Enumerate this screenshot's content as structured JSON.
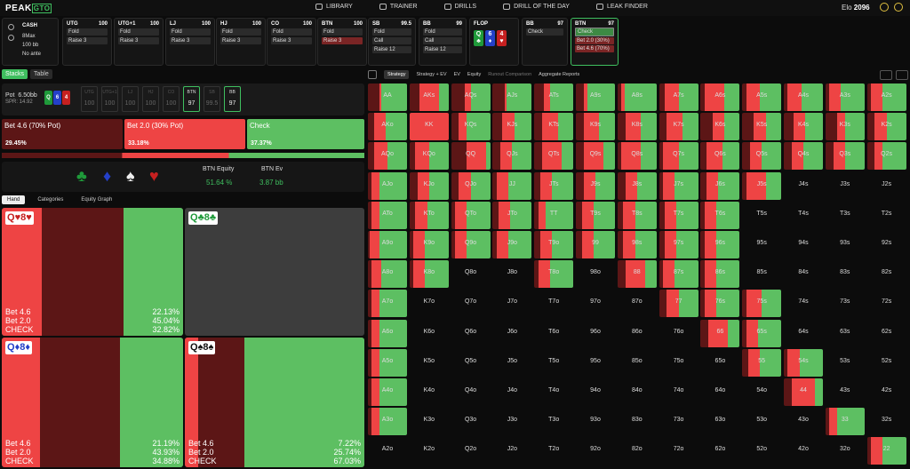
{
  "colors": {
    "bet_big": "#ee4444",
    "bet_small": "#5c1616",
    "check": "#5dbf62",
    "empty": "#0c0c0c",
    "accent": "#3fbf5f"
  },
  "app": {
    "logo_left": "PEAK",
    "logo_right": "GTO"
  },
  "nav": [
    {
      "label": "LIBRARY",
      "icon": "library-icon"
    },
    {
      "label": "TRAINER",
      "icon": "trainer-icon"
    },
    {
      "label": "DRILLS",
      "icon": "drills-icon"
    },
    {
      "label": "DRILL OF THE DAY",
      "icon": "drill-of-the-day-icon"
    },
    {
      "label": "LEAK FINDER",
      "icon": "leak-finder-icon"
    }
  ],
  "elo": {
    "label": "Elo",
    "value": "2096"
  },
  "game": {
    "type": "CASH",
    "max": "8Max",
    "stack": "100 bb",
    "ante": "No ante"
  },
  "positions": [
    {
      "name": "UTG",
      "stack": "100",
      "actions": [
        "Fold",
        "Raise 3"
      ],
      "styles": [
        "",
        ""
      ]
    },
    {
      "name": "UTG+1",
      "stack": "100",
      "actions": [
        "Fold",
        "Raise 3"
      ],
      "styles": [
        "",
        ""
      ]
    },
    {
      "name": "LJ",
      "stack": "100",
      "actions": [
        "Fold",
        "Raise 3"
      ],
      "styles": [
        "",
        ""
      ]
    },
    {
      "name": "HJ",
      "stack": "100",
      "actions": [
        "Fold",
        "Raise 3"
      ],
      "styles": [
        "",
        ""
      ]
    },
    {
      "name": "CO",
      "stack": "100",
      "actions": [
        "Fold",
        "Raise 3"
      ],
      "styles": [
        "",
        ""
      ]
    },
    {
      "name": "BTN",
      "stack": "100",
      "actions": [
        "Fold",
        "Raise 3"
      ],
      "styles": [
        "",
        "red"
      ]
    },
    {
      "name": "SB",
      "stack": "99.5",
      "actions": [
        "Fold",
        "Call",
        "Raise 12"
      ],
      "styles": [
        "",
        "",
        ""
      ]
    },
    {
      "name": "BB",
      "stack": "99",
      "actions": [
        "Fold",
        "Call",
        "Raise 12"
      ],
      "styles": [
        "",
        "",
        ""
      ]
    }
  ],
  "flop": {
    "label": "FLOP",
    "cards": [
      {
        "rank": "Q",
        "suit": "♣",
        "color": "#1f9a3a"
      },
      {
        "rank": "6",
        "suit": "♦",
        "color": "#2440c8"
      },
      {
        "rank": "4",
        "suit": "♥",
        "color": "#c62020"
      }
    ]
  },
  "bb_flop": {
    "name": "BB",
    "stack": "97",
    "action": "Check"
  },
  "btn_flop": {
    "name": "BTN",
    "stack": "97",
    "actions": [
      "Check",
      "Bet 2.0 (30%)",
      "Bet 4.6 (70%)"
    ]
  },
  "left_tabs": [
    "Stacks",
    "Table"
  ],
  "pot": {
    "label": "Pot",
    "value": "6.50bb",
    "spr": "SPR: 14.92"
  },
  "seats": [
    {
      "name": "UTG",
      "stack": "100",
      "on": false
    },
    {
      "name": "UTG+1",
      "stack": "100",
      "on": false
    },
    {
      "name": "LJ",
      "stack": "100",
      "on": false
    },
    {
      "name": "HJ",
      "stack": "100",
      "on": false
    },
    {
      "name": "CO",
      "stack": "100",
      "on": false
    },
    {
      "name": "BTN",
      "stack": "97",
      "on": true
    },
    {
      "name": "SB",
      "stack": "99.5",
      "on": false
    },
    {
      "name": "BB",
      "stack": "97",
      "on": true
    }
  ],
  "action_boxes": [
    {
      "label": "Bet 4.6 (70% Pot)",
      "pct": "29.45%"
    },
    {
      "label": "Bet 2.0 (30% Pot)",
      "pct": "33.18%"
    },
    {
      "label": "Check",
      "pct": "37.37%"
    }
  ],
  "strategy_split": {
    "bet_big": 0.2945,
    "bet_small": 0.3318,
    "check": 0.3737
  },
  "equity": {
    "equity_label": "BTN Equity",
    "equity_value": "51.64 %",
    "ev_label": "BTN Ev",
    "ev_value": "3.87 bb"
  },
  "hand_tabs": [
    "Hand",
    "Categories",
    "Equity Graph"
  ],
  "combos": [
    {
      "card1": "Q",
      "suit1": "♥",
      "card2": "8",
      "suit2": "♥",
      "color": "#c62020",
      "actions": [
        "Bet 4.6",
        "Bet 2.0",
        "CHECK"
      ],
      "pcts": [
        "22.13%",
        "45.04%",
        "32.82%"
      ],
      "split": [
        0.2213,
        0.4504,
        0.3282
      ]
    },
    {
      "card1": "Q",
      "suit1": "♣",
      "card2": "8",
      "suit2": "♣",
      "color": "#1f9a3a",
      "actions": [],
      "pcts": [],
      "split": [
        0,
        0,
        0
      ]
    },
    {
      "card1": "Q",
      "suit1": "♦",
      "card2": "8",
      "suit2": "♦",
      "color": "#2440c8",
      "actions": [
        "Bet 4.6",
        "Bet 2.0",
        "CHECK"
      ],
      "pcts": [
        "21.19%",
        "43.93%",
        "34.88%"
      ],
      "split": [
        0.2119,
        0.4393,
        0.3488
      ]
    },
    {
      "card1": "Q",
      "suit1": "♠",
      "card2": "8",
      "suit2": "♠",
      "color": "#111111",
      "actions": [
        "Bet 4.6",
        "Bet 2.0",
        "CHECK"
      ],
      "pcts": [
        "7.22%",
        "25.74%",
        "67.03%"
      ],
      "split": [
        0.0722,
        0.2574,
        0.6703
      ]
    }
  ],
  "right_tabs": [
    {
      "label": "Strategy",
      "style": "on"
    },
    {
      "label": "Strategy + EV",
      "style": ""
    },
    {
      "label": "EV",
      "style": ""
    },
    {
      "label": "Equity",
      "style": ""
    },
    {
      "label": "Runout Comparison",
      "style": "dim"
    },
    {
      "label": "Aggregate Reports",
      "style": ""
    }
  ],
  "ranks": [
    "A",
    "K",
    "Q",
    "J",
    "T",
    "9",
    "8",
    "7",
    "6",
    "5",
    "4",
    "3",
    "2"
  ],
  "grid_mix": [
    [
      [
        0.3,
        0.05,
        0.65
      ],
      [
        0.25,
        0.5,
        0.25
      ],
      [
        0.35,
        0.15,
        0.5
      ],
      [
        0.3,
        0.05,
        0.65
      ],
      [
        0.25,
        0.15,
        0.6
      ],
      [
        0.2,
        0.1,
        0.7
      ],
      [
        0.1,
        0.08,
        0.82
      ],
      [
        0.15,
        0.35,
        0.5
      ],
      [
        0.1,
        0.5,
        0.4
      ],
      [
        0.1,
        0.35,
        0.55
      ],
      [
        0.1,
        0.35,
        0.55
      ],
      [
        0.1,
        0.3,
        0.6
      ],
      [
        0.1,
        0.3,
        0.6
      ]
    ],
    [
      [
        0.15,
        0.3,
        0.55
      ],
      [
        0,
        1,
        0
      ],
      [
        0.2,
        0.2,
        0.6
      ],
      [
        0.25,
        0.3,
        0.45
      ],
      [
        0.2,
        0.4,
        0.4
      ],
      [
        0.2,
        0.4,
        0.4
      ],
      [
        0.2,
        0.4,
        0.4
      ],
      [
        0.2,
        0.4,
        0.4
      ],
      [
        0.3,
        0.3,
        0.4
      ],
      [
        0.3,
        0.3,
        0.4
      ],
      [
        0.25,
        0.3,
        0.45
      ],
      [
        0.3,
        0.2,
        0.5
      ],
      [
        0.2,
        0.3,
        0.5
      ]
    ],
    [
      [
        0.15,
        0.35,
        0.5
      ],
      [
        0.15,
        0.35,
        0.5
      ],
      [
        0.4,
        0.5,
        0.1
      ],
      [
        0.2,
        0.3,
        0.5
      ],
      [
        0.2,
        0.5,
        0.3
      ],
      [
        0.2,
        0.5,
        0.3
      ],
      [
        0.1,
        0.5,
        0.4
      ],
      [
        0.1,
        0.4,
        0.5
      ],
      [
        0.15,
        0.4,
        0.45
      ],
      [
        0.2,
        0.3,
        0.5
      ],
      [
        0.2,
        0.3,
        0.5
      ],
      [
        0.2,
        0.3,
        0.5
      ],
      [
        0.2,
        0.2,
        0.6
      ]
    ],
    [
      [
        0.1,
        0.2,
        0.7
      ],
      [
        0.2,
        0.3,
        0.5
      ],
      [
        0.2,
        0.3,
        0.5
      ],
      [
        0.1,
        0.3,
        0.6
      ],
      [
        0.15,
        0.3,
        0.55
      ],
      [
        0.2,
        0.3,
        0.5
      ],
      [
        0.2,
        0.3,
        0.5
      ],
      [
        0.1,
        0.3,
        0.6
      ],
      [
        0.15,
        0.3,
        0.55
      ],
      [
        0.1,
        0.5,
        0.4
      ],
      [
        0,
        0,
        0
      ],
      [
        0,
        0,
        0
      ],
      [
        0,
        0,
        0
      ]
    ],
    [
      [
        0.1,
        0.2,
        0.7
      ],
      [
        0.15,
        0.3,
        0.55
      ],
      [
        0.1,
        0.3,
        0.6
      ],
      [
        0.15,
        0.3,
        0.55
      ],
      [
        0.1,
        0.2,
        0.7
      ],
      [
        0.15,
        0.3,
        0.55
      ],
      [
        0.15,
        0.3,
        0.55
      ],
      [
        0.15,
        0.3,
        0.55
      ],
      [
        0.1,
        0.3,
        0.6
      ],
      [
        0,
        0,
        0
      ],
      [
        0,
        0,
        0
      ],
      [
        0,
        0,
        0
      ],
      [
        0,
        0,
        0
      ]
    ],
    [
      [
        0.05,
        0.25,
        0.7
      ],
      [
        0.1,
        0.3,
        0.6
      ],
      [
        0.1,
        0.3,
        0.6
      ],
      [
        0.1,
        0.3,
        0.6
      ],
      [
        0.15,
        0.3,
        0.55
      ],
      [
        0.15,
        0.3,
        0.55
      ],
      [
        0.15,
        0.3,
        0.55
      ],
      [
        0.15,
        0.3,
        0.55
      ],
      [
        0.1,
        0.3,
        0.6
      ],
      [
        0,
        0,
        0
      ],
      [
        0,
        0,
        0
      ],
      [
        0,
        0,
        0
      ],
      [
        0,
        0,
        0
      ]
    ],
    [
      [
        0.1,
        0.25,
        0.65
      ],
      [
        0.1,
        0.3,
        0.6
      ],
      [
        0,
        0,
        0
      ],
      [
        0,
        0,
        0
      ],
      [
        0.1,
        0.3,
        0.6
      ],
      [
        0,
        0,
        0
      ],
      [
        0.2,
        0.5,
        0.3
      ],
      [
        0.1,
        0.3,
        0.6
      ],
      [
        0.1,
        0.3,
        0.6
      ],
      [
        0,
        0,
        0
      ],
      [
        0,
        0,
        0
      ],
      [
        0,
        0,
        0
      ],
      [
        0,
        0,
        0
      ]
    ],
    [
      [
        0.1,
        0.2,
        0.7
      ],
      [
        0,
        0,
        0
      ],
      [
        0,
        0,
        0
      ],
      [
        0,
        0,
        0
      ],
      [
        0,
        0,
        0
      ],
      [
        0,
        0,
        0
      ],
      [
        0,
        0,
        0
      ],
      [
        0.2,
        0.3,
        0.5
      ],
      [
        0.1,
        0.3,
        0.6
      ],
      [
        0.1,
        0.4,
        0.5
      ],
      [
        0,
        0,
        0
      ],
      [
        0,
        0,
        0
      ],
      [
        0,
        0,
        0
      ]
    ],
    [
      [
        0.1,
        0.2,
        0.7
      ],
      [
        0,
        0,
        0
      ],
      [
        0,
        0,
        0
      ],
      [
        0,
        0,
        0
      ],
      [
        0,
        0,
        0
      ],
      [
        0,
        0,
        0
      ],
      [
        0,
        0,
        0
      ],
      [
        0,
        0,
        0
      ],
      [
        0.2,
        0.5,
        0.3
      ],
      [
        0.1,
        0.3,
        0.6
      ],
      [
        0,
        0,
        0
      ],
      [
        0,
        0,
        0
      ],
      [
        0,
        0,
        0
      ]
    ],
    [
      [
        0.1,
        0.2,
        0.7
      ],
      [
        0,
        0,
        0
      ],
      [
        0,
        0,
        0
      ],
      [
        0,
        0,
        0
      ],
      [
        0,
        0,
        0
      ],
      [
        0,
        0,
        0
      ],
      [
        0,
        0,
        0
      ],
      [
        0,
        0,
        0
      ],
      [
        0,
        0,
        0
      ],
      [
        0.15,
        0.3,
        0.55
      ],
      [
        0.1,
        0.3,
        0.6
      ],
      [
        0,
        0,
        0
      ],
      [
        0,
        0,
        0
      ]
    ],
    [
      [
        0.1,
        0.2,
        0.7
      ],
      [
        0,
        0,
        0
      ],
      [
        0,
        0,
        0
      ],
      [
        0,
        0,
        0
      ],
      [
        0,
        0,
        0
      ],
      [
        0,
        0,
        0
      ],
      [
        0,
        0,
        0
      ],
      [
        0,
        0,
        0
      ],
      [
        0,
        0,
        0
      ],
      [
        0,
        0,
        0
      ],
      [
        0.2,
        0.6,
        0.2
      ],
      [
        0,
        0,
        0
      ],
      [
        0,
        0,
        0
      ]
    ],
    [
      [
        0.1,
        0.2,
        0.7
      ],
      [
        0,
        0,
        0
      ],
      [
        0,
        0,
        0
      ],
      [
        0,
        0,
        0
      ],
      [
        0,
        0,
        0
      ],
      [
        0,
        0,
        0
      ],
      [
        0,
        0,
        0
      ],
      [
        0,
        0,
        0
      ],
      [
        0,
        0,
        0
      ],
      [
        0,
        0,
        0
      ],
      [
        0,
        0,
        0
      ],
      [
        0.1,
        0.2,
        0.7
      ],
      [
        0,
        0,
        0
      ]
    ],
    [
      [
        0,
        0,
        0
      ],
      [
        0,
        0,
        0
      ],
      [
        0,
        0,
        0
      ],
      [
        0,
        0,
        0
      ],
      [
        0,
        0,
        0
      ],
      [
        0,
        0,
        0
      ],
      [
        0,
        0,
        0
      ],
      [
        0,
        0,
        0
      ],
      [
        0,
        0,
        0
      ],
      [
        0,
        0,
        0
      ],
      [
        0,
        0,
        0
      ],
      [
        0,
        0,
        0
      ],
      [
        0.1,
        0.3,
        0.6
      ]
    ]
  ]
}
